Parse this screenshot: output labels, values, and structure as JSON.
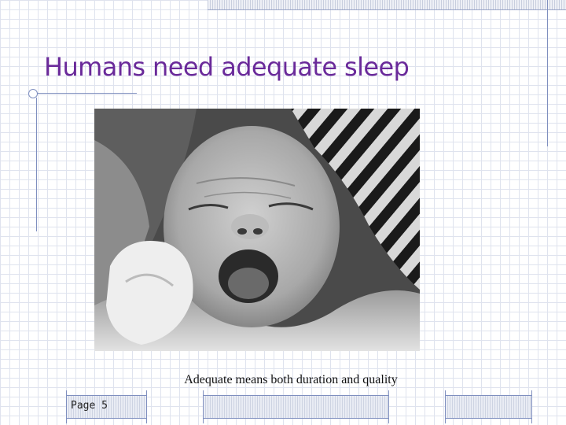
{
  "slide": {
    "title": "Humans need adequate sleep",
    "caption": "Adequate means both duration and quality",
    "page_label": "Page 5"
  },
  "image": {
    "subject": "grayscale photo of a yawning newborn baby wrapped in a blanket"
  },
  "colors": {
    "title": "#6a2a9a",
    "rules": "#7f8fbf",
    "grid": "#dfe3ee"
  }
}
